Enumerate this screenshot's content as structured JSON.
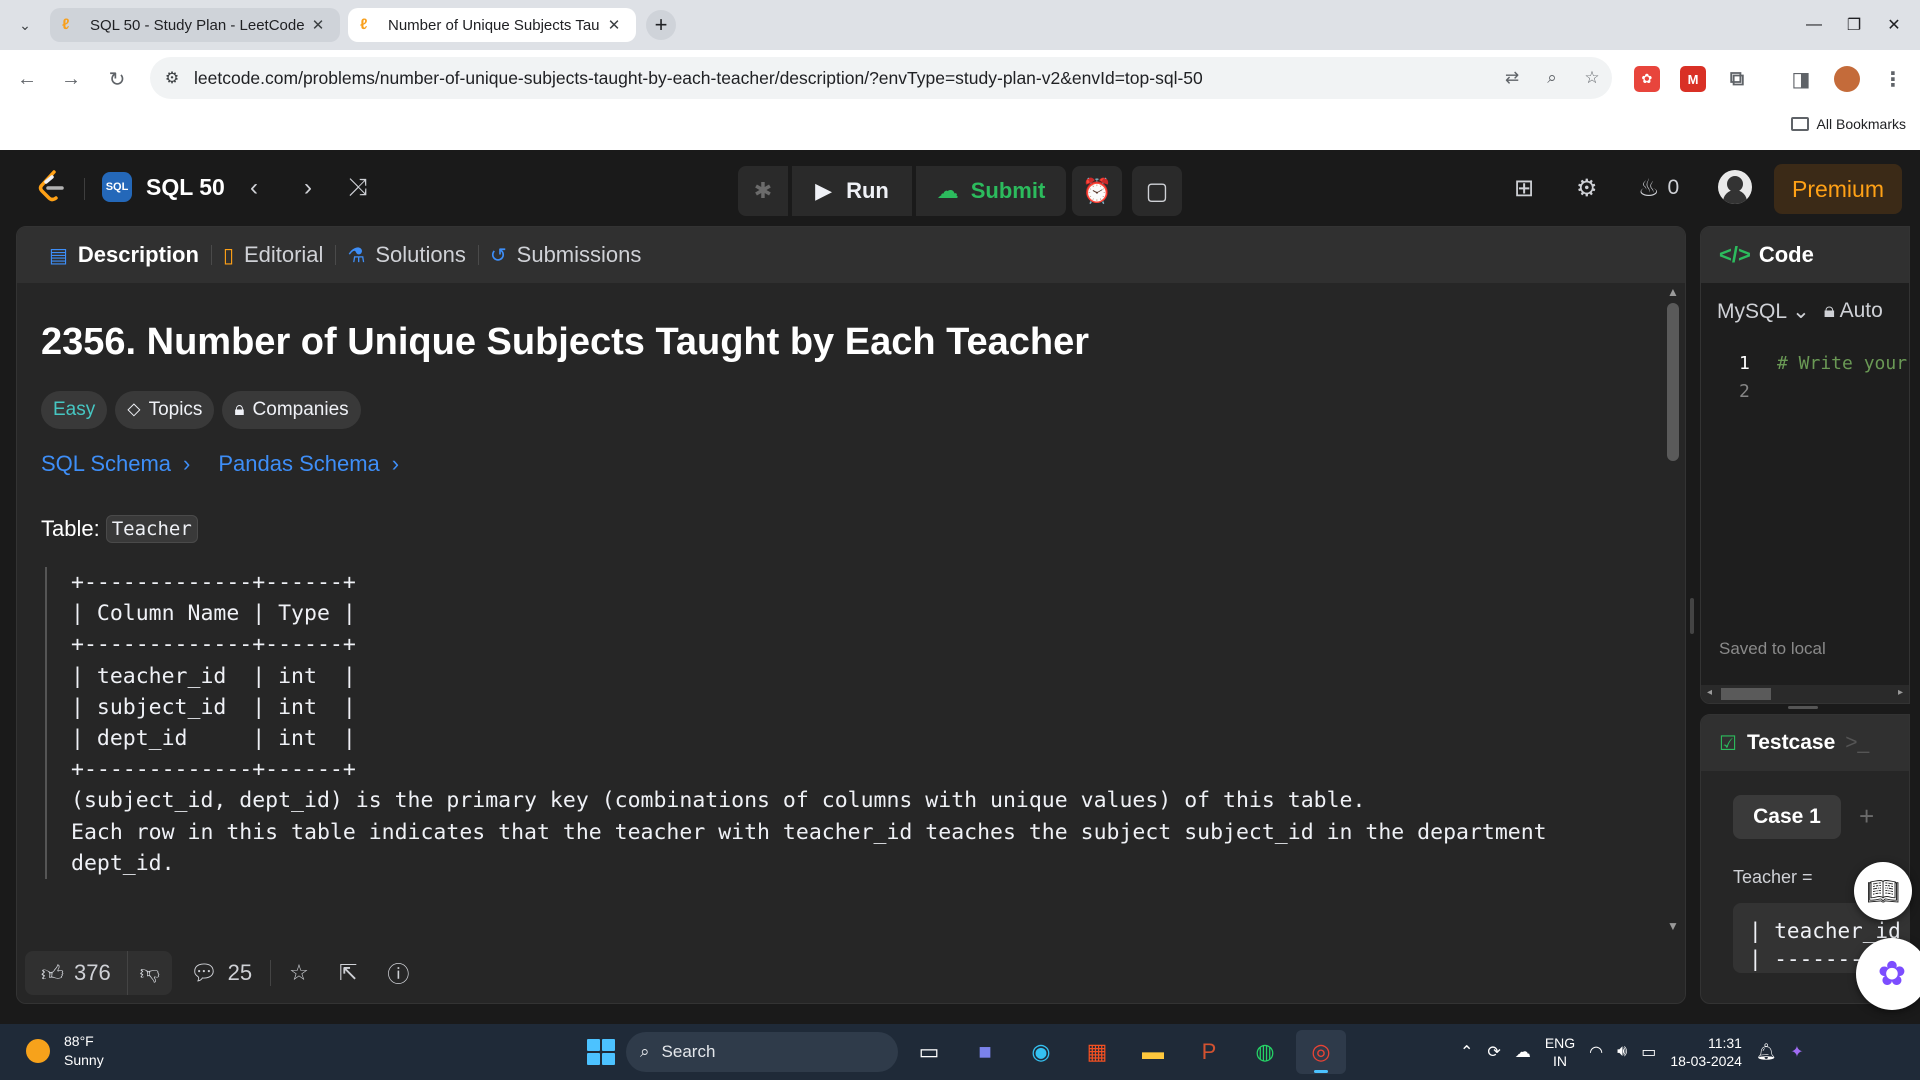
{
  "browser": {
    "tabs": [
      {
        "title": "SQL 50 - Study Plan - LeetCode",
        "active": false
      },
      {
        "title": "Number of Unique Subjects Tau",
        "active": true
      }
    ],
    "url": "leetcode.com/problems/number-of-unique-subjects-taught-by-each-teacher/description/?envType=study-plan-v2&envId=top-sql-50",
    "bookmarks_label": "All Bookmarks"
  },
  "lc_top": {
    "study_plan": "SQL 50",
    "run_label": "Run",
    "submit_label": "Submit",
    "streak_count": "0",
    "premium_label": "Premium"
  },
  "desc_tabs": {
    "description": "Description",
    "editorial": "Editorial",
    "solutions": "Solutions",
    "submissions": "Submissions"
  },
  "problem": {
    "title": "2356. Number of Unique Subjects Taught by Each Teacher",
    "difficulty": "Easy",
    "topics": "Topics",
    "companies": "Companies",
    "sql_schema": "SQL Schema",
    "pandas_schema": "Pandas Schema",
    "table_prefix": "Table:",
    "table_name": "Teacher",
    "schema_block": "+-------------+------+\n| Column Name | Type |\n+-------------+------+\n| teacher_id  | int  |\n| subject_id  | int  |\n| dept_id     | int  |\n+-------------+------+\n(subject_id, dept_id) is the primary key (combinations of columns with unique values) of this table.\nEach row in this table indicates that the teacher with teacher_id teaches the subject subject_id in the department\ndept_id."
  },
  "footer": {
    "likes": "376",
    "comments": "25"
  },
  "code_panel": {
    "title": "Code",
    "language": "MySQL",
    "auto_label": "Auto",
    "lines": [
      {
        "num": "1",
        "text": "# Write your"
      },
      {
        "num": "2",
        "text": ""
      }
    ],
    "saved_status": "Saved to local"
  },
  "test_panel": {
    "title": "Testcase",
    "case_label": "Case 1",
    "input_label": "Teacher =",
    "input_preview": "| teacher_id\n| ----------"
  },
  "taskbar": {
    "temperature": "88°F",
    "weather": "Sunny",
    "search_placeholder": "Search",
    "lang_line1": "ENG",
    "lang_line2": "IN",
    "time": "11:31",
    "date": "18-03-2024"
  },
  "colors": {
    "accent_orange": "#ffa116",
    "submit_green": "#2cbb5d",
    "easy_teal": "#46c6c2",
    "link_blue": "#3e8ef7"
  }
}
